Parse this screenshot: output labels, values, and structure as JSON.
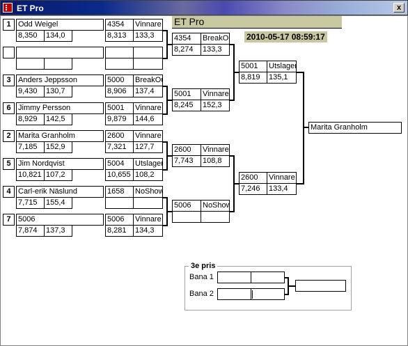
{
  "window": {
    "title": "ET Pro",
    "close_label": "x"
  },
  "header": {
    "title": "ET Pro",
    "datetime": "2010-05-17 08:59:17"
  },
  "round1": [
    {
      "seed": "1",
      "name": "Odd Weigel",
      "time": "8,350",
      "speed": "134,0"
    },
    {
      "seed": "",
      "name": "",
      "time": "",
      "speed": ""
    },
    {
      "seed": "3",
      "name": "Anders Jeppsson",
      "time": "9,430",
      "speed": "130,7"
    },
    {
      "seed": "6",
      "name": "Jimmy Persson",
      "time": "8,929",
      "speed": "142,5"
    },
    {
      "seed": "2",
      "name": "Marita Granholm",
      "time": "7,185",
      "speed": "152,9"
    },
    {
      "seed": "5",
      "name": "Jim Nordqvist",
      "time": "10,821",
      "speed": "107,2"
    },
    {
      "seed": "4",
      "name": "Carl-erik Näslund",
      "time": "7,715",
      "speed": "155,4"
    },
    {
      "seed": "7",
      "name": "5006",
      "time": "7,874",
      "speed": "137,3"
    }
  ],
  "round2": [
    {
      "id": "4354",
      "result": "Vinnare",
      "time": "8,313",
      "speed": "133,3"
    },
    {
      "id": "",
      "result": "",
      "time": "",
      "speed": ""
    },
    {
      "id": "5000",
      "result": "BreakOut",
      "time": "8,906",
      "speed": "137,4"
    },
    {
      "id": "5001",
      "result": "Vinnare",
      "time": "9,879",
      "speed": "144,6"
    },
    {
      "id": "2600",
      "result": "Vinnare",
      "time": "7,321",
      "speed": "127,7"
    },
    {
      "id": "5004",
      "result": "Utslagen",
      "time": "10,655",
      "speed": "108,2"
    },
    {
      "id": "1658",
      "result": "NoShow",
      "time": "",
      "speed": ""
    },
    {
      "id": "5006",
      "result": "Vinnare",
      "time": "8,281",
      "speed": "134,3"
    }
  ],
  "round3": [
    {
      "id": "4354",
      "result": "BreakOut",
      "time": "8,274",
      "speed": "133,3"
    },
    {
      "id": "5001",
      "result": "Vinnare",
      "time": "8,245",
      "speed": "152,3"
    },
    {
      "id": "2600",
      "result": "Vinnare",
      "time": "7,743",
      "speed": "108,8"
    },
    {
      "id": "5006",
      "result": "NoShow",
      "time": "",
      "speed": ""
    }
  ],
  "round4": [
    {
      "id": "5001",
      "result": "Utslagen",
      "time": "8,819",
      "speed": "135,1"
    },
    {
      "id": "2600",
      "result": "Vinnare",
      "time": "7,246",
      "speed": "133,4"
    }
  ],
  "winner": {
    "name": "Marita Granholm"
  },
  "third_place": {
    "label": "3e pris",
    "lane1": "Bana 1",
    "lane2": "Bana 2"
  }
}
